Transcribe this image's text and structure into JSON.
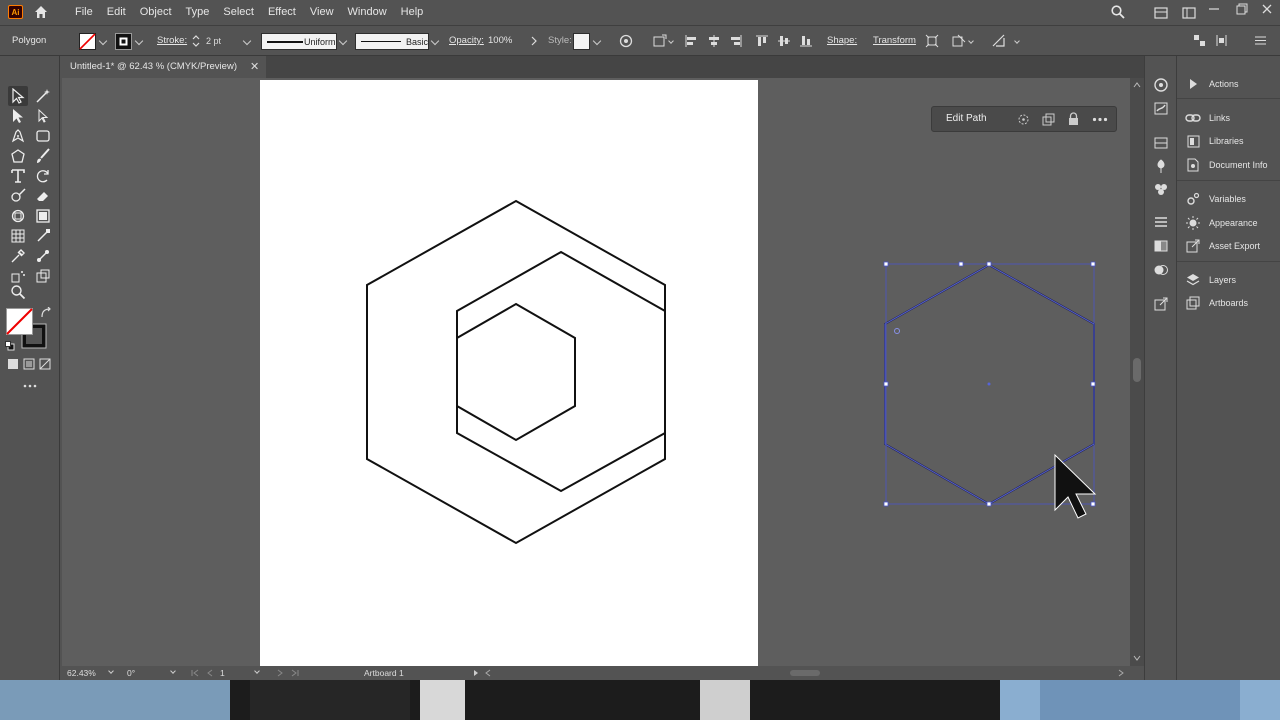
{
  "app": {
    "logo": "Ai"
  },
  "menu": [
    "File",
    "Edit",
    "Object",
    "Type",
    "Select",
    "Effect",
    "View",
    "Window",
    "Help"
  ],
  "control": {
    "object_type": "Polygon",
    "stroke_label": "Stroke:",
    "stroke_weight": "2 pt",
    "profile_uniform": "Uniform",
    "brush_basic": "Basic",
    "opacity_label": "Opacity:",
    "opacity_value": "100%",
    "style_label": "Style:",
    "shape_label": "Shape:",
    "transform_label": "Transform"
  },
  "document": {
    "tab_title": "Untitled-1* @ 62.43 % (CMYK/Preview)",
    "close_glyph": "✕"
  },
  "context": {
    "edit_path": "Edit Path"
  },
  "status": {
    "zoom": "62.43%",
    "rotation": "0°",
    "artboard_index": "1",
    "artboard_name": "Artboard 1"
  },
  "panels": [
    {
      "label": "Actions",
      "icon": "actions-icon"
    },
    {
      "label": "Links",
      "icon": "links-icon"
    },
    {
      "label": "Libraries",
      "icon": "libraries-icon"
    },
    {
      "label": "Document Info",
      "icon": "document-info-icon"
    },
    {
      "label": "Variables",
      "icon": "variables-icon"
    },
    {
      "label": "Appearance",
      "icon": "appearance-icon"
    },
    {
      "label": "Asset Export",
      "icon": "asset-export-icon"
    },
    {
      "label": "Layers",
      "icon": "layers-icon"
    },
    {
      "label": "Artboards",
      "icon": "artboards-icon"
    }
  ],
  "colors": {
    "ui_bg": "#535353",
    "canvas_bg": "#5e5e5e",
    "selection": "#4a56c8",
    "artboard": "#ffffff",
    "brand": "#ff9a00"
  }
}
